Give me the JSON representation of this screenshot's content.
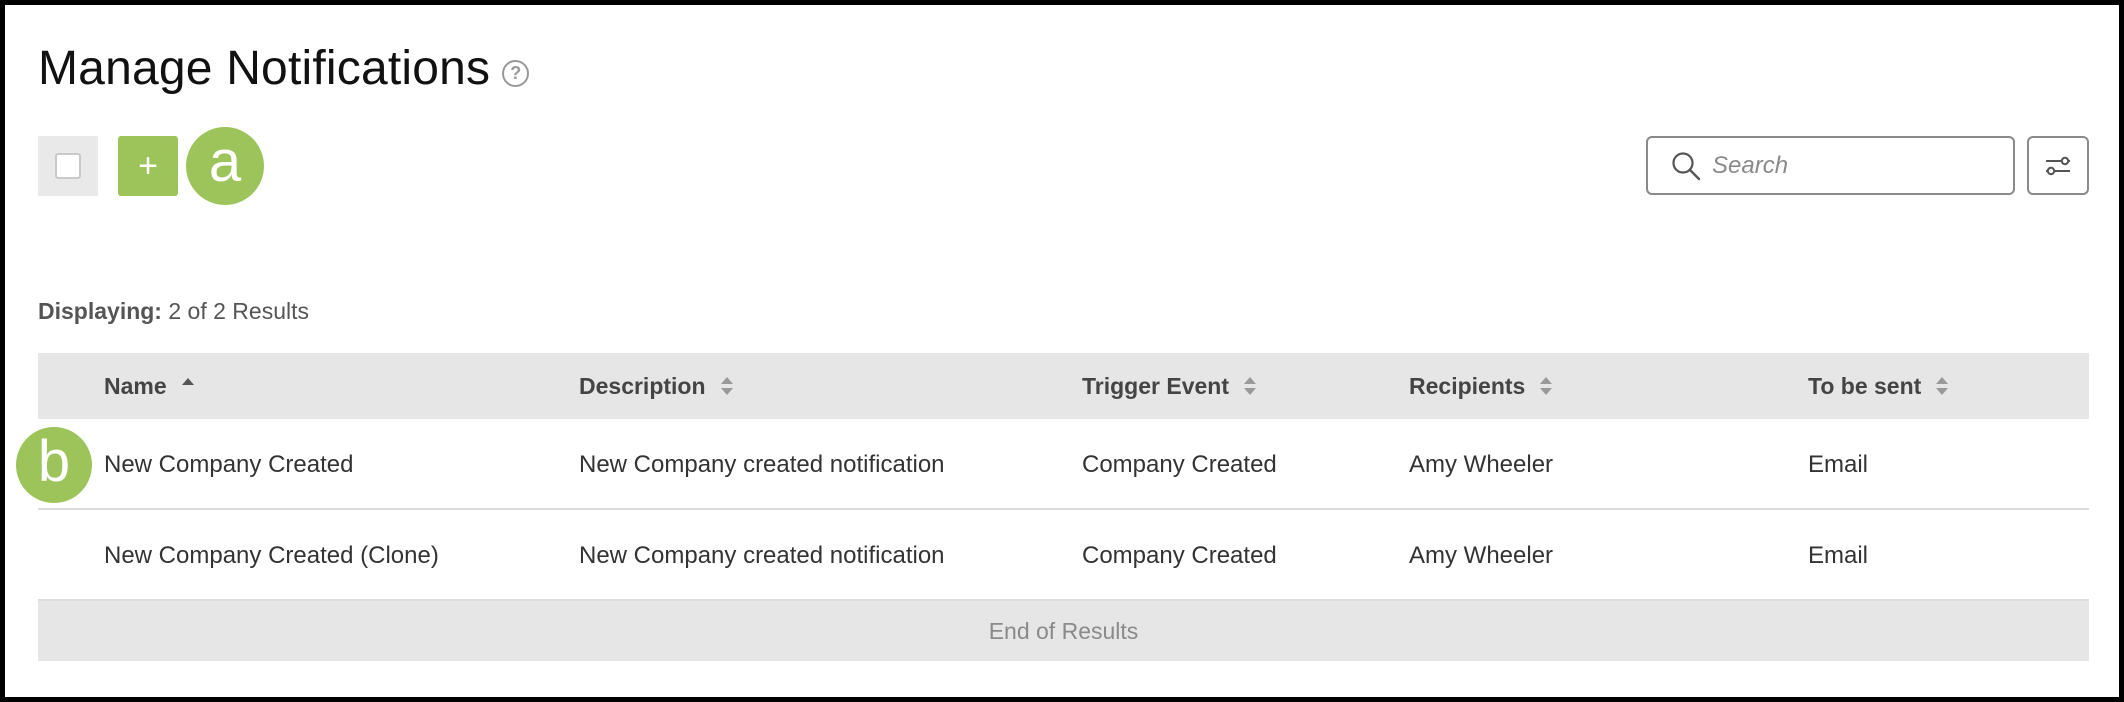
{
  "page": {
    "title": "Manage Notifications",
    "help_icon": "question-circle-icon"
  },
  "toolbar": {
    "add_label": "+",
    "search_placeholder": "Search",
    "search_icon": "magnifier-icon",
    "filter_icon": "sliders-icon"
  },
  "callouts": {
    "a": "a",
    "b": "b"
  },
  "results": {
    "label": "Displaying:",
    "value": "2 of 2 Results"
  },
  "table": {
    "columns": [
      {
        "label": "Name",
        "sort": "ascending"
      },
      {
        "label": "Description",
        "sort": "none"
      },
      {
        "label": "Trigger Event",
        "sort": "none"
      },
      {
        "label": "Recipients",
        "sort": "none"
      },
      {
        "label": "To be sent",
        "sort": "none"
      }
    ],
    "rows": [
      {
        "name": "New Company Created",
        "description": "New Company created notification",
        "trigger": "Company Created",
        "recipients": "Amy Wheeler",
        "send": "Email"
      },
      {
        "name": "New Company Created (Clone)",
        "description": "New Company created notification",
        "trigger": "Company Created",
        "recipients": "Amy Wheeler",
        "send": "Email"
      }
    ],
    "footer": "End of Results"
  },
  "colors": {
    "accent": "#9dc45a",
    "header_bg": "#e6e6e6"
  }
}
